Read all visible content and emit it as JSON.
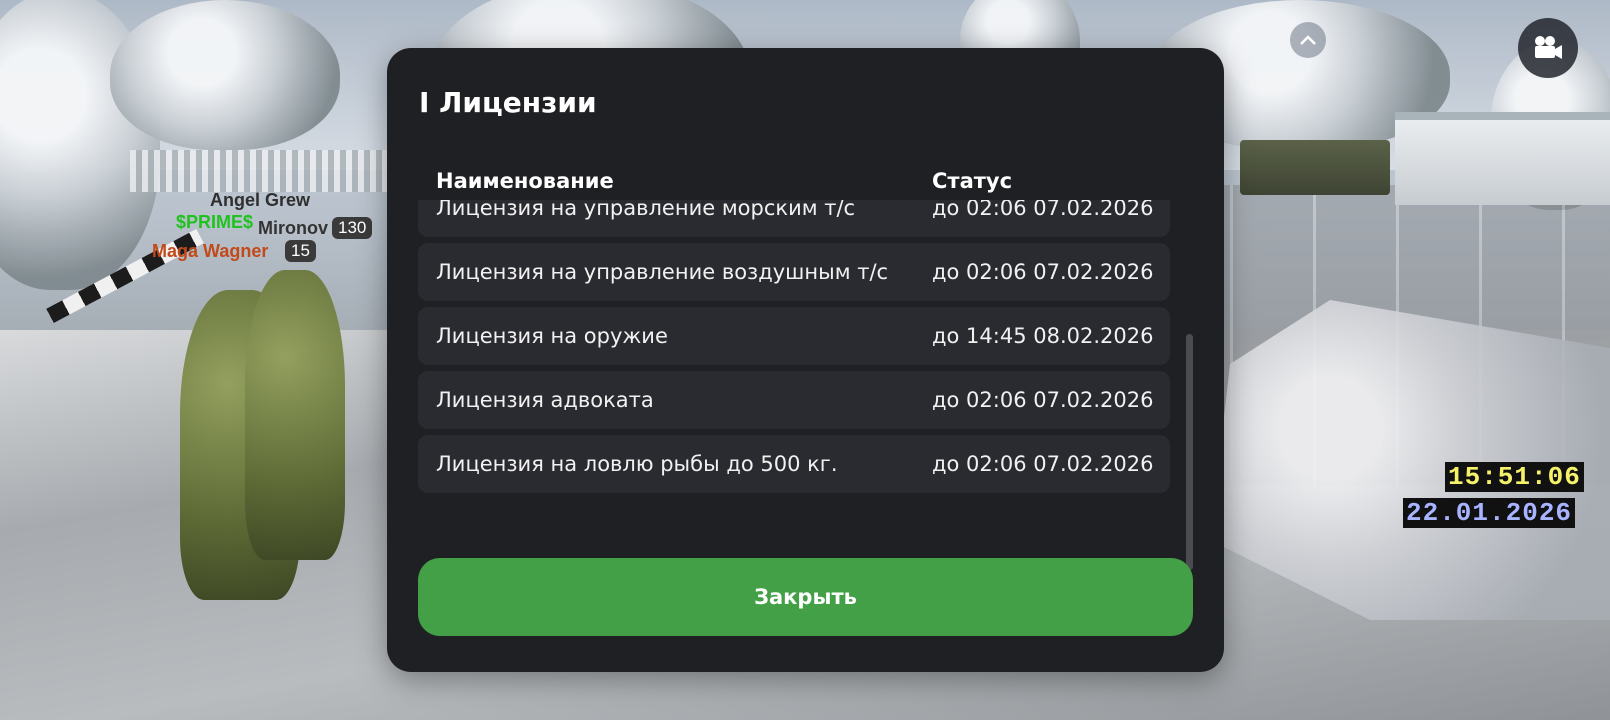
{
  "dialog": {
    "title": "I Лицензии",
    "columns": {
      "name": "Наименование",
      "status": "Статус"
    },
    "licenses": [
      {
        "name": "Лицензия на управление морским т/с",
        "status": "до 02:06 07.02.2026"
      },
      {
        "name": "Лицензия на управление воздушным т/с",
        "status": "до 02:06 07.02.2026"
      },
      {
        "name": "Лицензия на оружие",
        "status": "до 14:45 08.02.2026"
      },
      {
        "name": "Лицензия адвоката",
        "status": "до 02:06 07.02.2026"
      },
      {
        "name": "Лицензия на ловлю рыбы до 500 кг.",
        "status": "до 02:06 07.02.2026"
      }
    ],
    "close_label": "Закрыть"
  },
  "hud": {
    "time": "15:51:06",
    "date": "22.01.2026"
  },
  "players": {
    "nick_1": "Angel Grew",
    "nick_2": "$PRIME$",
    "nick_3": "Mironov",
    "nick_3_level": "130",
    "nick_4": "Maga Wagner",
    "nick_4_level": "15"
  },
  "icons": {
    "top": "chevron-up-icon",
    "camera": "video-camera-icon"
  },
  "colors": {
    "dialog_bg": "#1f2024",
    "row_bg": "#2a2b30",
    "close_button": "#43a047",
    "hud_time": "#f5f26a",
    "hud_date": "#a8b4ff"
  }
}
